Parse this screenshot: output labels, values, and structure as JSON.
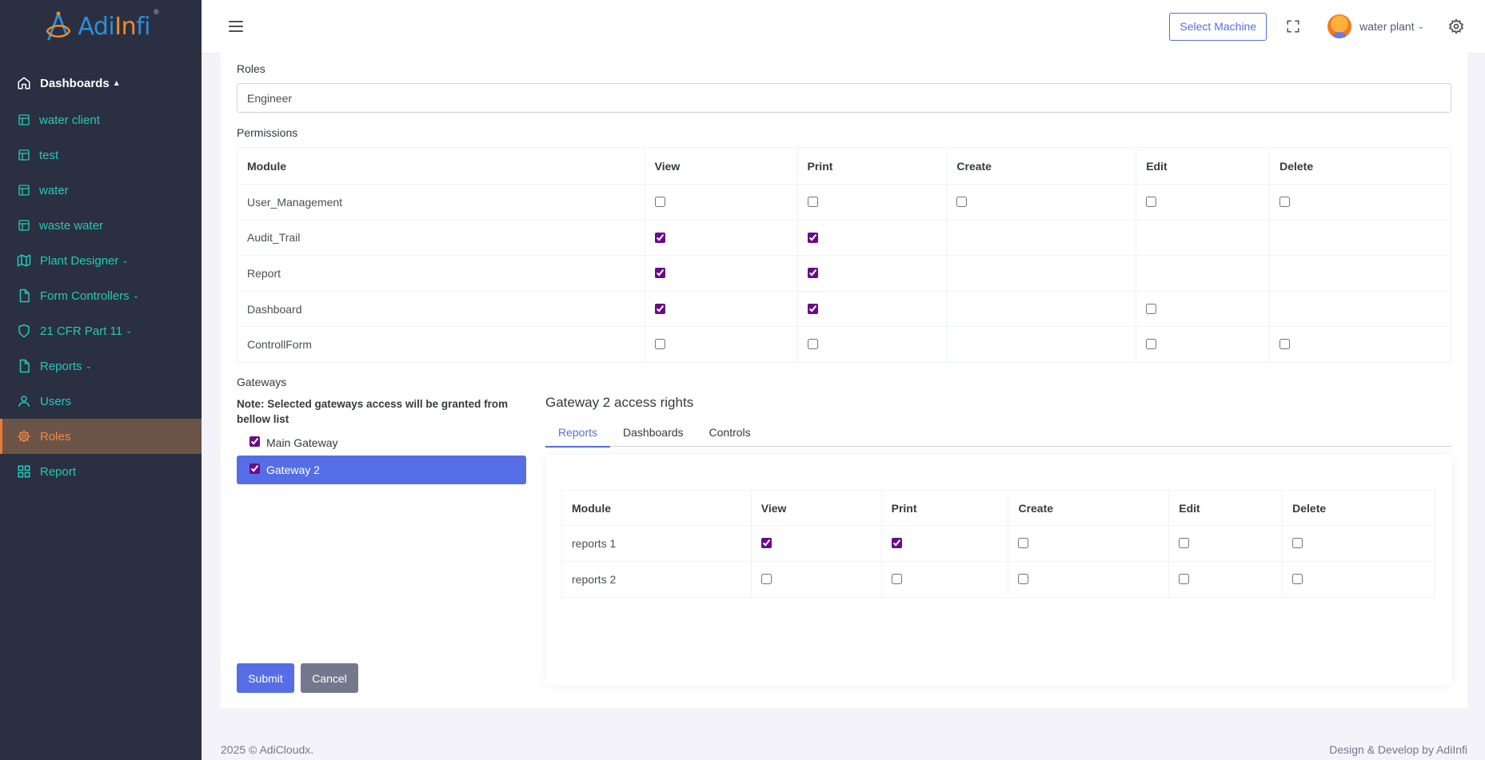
{
  "brand": {
    "logo_text_a": "Adi",
    "logo_text_b": "In",
    "logo_text_c": "fi",
    "reg": "®"
  },
  "sidebar": {
    "items": [
      {
        "label": "Dashboards",
        "icon": "home-icon",
        "chevron": "⌃"
      },
      {
        "label": "water client",
        "icon": "layout-icon"
      },
      {
        "label": "test",
        "icon": "layout-icon"
      },
      {
        "label": "water",
        "icon": "layout-icon"
      },
      {
        "label": "waste water",
        "icon": "layout-icon"
      },
      {
        "label": "Plant Designer",
        "icon": "map-icon",
        "chevron": "⌄"
      },
      {
        "label": "Form Controllers",
        "icon": "file-icon",
        "chevron": "⌄"
      },
      {
        "label": "21 CFR Part 11",
        "icon": "shield-icon",
        "chevron": "⌄"
      },
      {
        "label": "Reports",
        "icon": "file-icon",
        "chevron": "⌄"
      },
      {
        "label": "Users",
        "icon": "user-icon"
      },
      {
        "label": "Roles",
        "icon": "gear-icon"
      },
      {
        "label": "Report",
        "icon": "grid-icon"
      }
    ]
  },
  "topbar": {
    "select_machine": "Select Machine",
    "user_name": "water plant",
    "user_chevron": "⌄"
  },
  "form": {
    "roles_label": "Roles",
    "roles_value": "Engineer",
    "permissions_label": "Permissions",
    "permissions": {
      "columns": [
        "Module",
        "View",
        "Print",
        "Create",
        "Edit",
        "Delete"
      ],
      "rows": [
        {
          "module": "User_Management",
          "cells": [
            false,
            false,
            false,
            false,
            false
          ]
        },
        {
          "module": "Audit_Trail",
          "cells": [
            true,
            true,
            null,
            null,
            null
          ]
        },
        {
          "module": "Report",
          "cells": [
            true,
            true,
            null,
            null,
            null
          ]
        },
        {
          "module": "Dashboard",
          "cells": [
            true,
            true,
            null,
            false,
            null
          ]
        },
        {
          "module": "ControllForm",
          "cells": [
            false,
            false,
            null,
            false,
            false
          ]
        }
      ]
    },
    "gateways_label": "Gateways",
    "gateways_note": "Note: Selected gateways access will be granted from bellow list",
    "gateways": [
      {
        "label": "Main Gateway",
        "checked": true,
        "selected": false
      },
      {
        "label": "Gateway 2",
        "checked": true,
        "selected": true
      }
    ],
    "gateway_title": "Gateway 2 access rights",
    "tabs": [
      {
        "label": "Reports",
        "active": true
      },
      {
        "label": "Dashboards",
        "active": false
      },
      {
        "label": "Controls",
        "active": false
      }
    ],
    "reports_table": {
      "columns": [
        "Module",
        "View",
        "Print",
        "Create",
        "Edit",
        "Delete"
      ],
      "rows": [
        {
          "module": "reports 1",
          "cells": [
            true,
            true,
            false,
            false,
            false
          ]
        },
        {
          "module": "reports 2",
          "cells": [
            false,
            false,
            false,
            false,
            false
          ]
        }
      ]
    },
    "submit_label": "Submit",
    "cancel_label": "Cancel"
  },
  "footer": {
    "left": "2025 © AdiCloudx.",
    "right": "Design & Develop by AdiInfi"
  }
}
